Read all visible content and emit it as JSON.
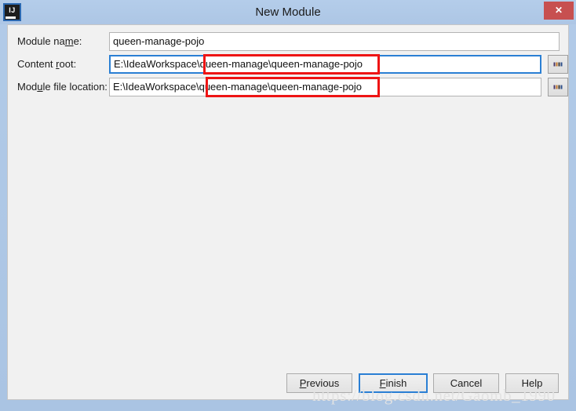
{
  "window": {
    "title": "New Module",
    "app_icon": "intellij-idea-icon",
    "icon_text": "IJ",
    "close_label": "✕"
  },
  "form": {
    "module_name": {
      "label_before": "Module na",
      "label_mnemonic": "m",
      "label_after": "e:",
      "value": "queen-manage-pojo"
    },
    "content_root": {
      "label_before": "Content ",
      "label_mnemonic": "r",
      "label_after": "oot:",
      "value": "E:\\IdeaWorkspace\\queen-manage\\queen-manage-pojo",
      "browse_label": "...",
      "focused": true
    },
    "module_file_location": {
      "label_before": "Mod",
      "label_mnemonic": "u",
      "label_after": "le file location:",
      "value": "E:\\IdeaWorkspace\\queen-manage\\queen-manage-pojo",
      "browse_label": "...",
      "focused": false
    }
  },
  "annotations": {
    "color": "#ee1414",
    "highlighted_text": "\\queen-manage\\queen-manage-pojo"
  },
  "buttons": {
    "previous": {
      "before": "",
      "mnemonic": "P",
      "after": "revious"
    },
    "finish": {
      "before": "",
      "mnemonic": "F",
      "after": "inish"
    },
    "cancel": {
      "before": "Cancel",
      "mnemonic": "",
      "after": ""
    },
    "help": {
      "before": "Help",
      "mnemonic": "",
      "after": ""
    }
  },
  "watermark": {
    "text": "https://blog.csdn.net/Gaomb_1990"
  },
  "colors": {
    "title_bar": "#aec7e6",
    "client_background": "#f1f1f1",
    "focus_blue": "#2a7fd4",
    "close_red": "#c75050",
    "annotation_red": "#ee1414"
  }
}
